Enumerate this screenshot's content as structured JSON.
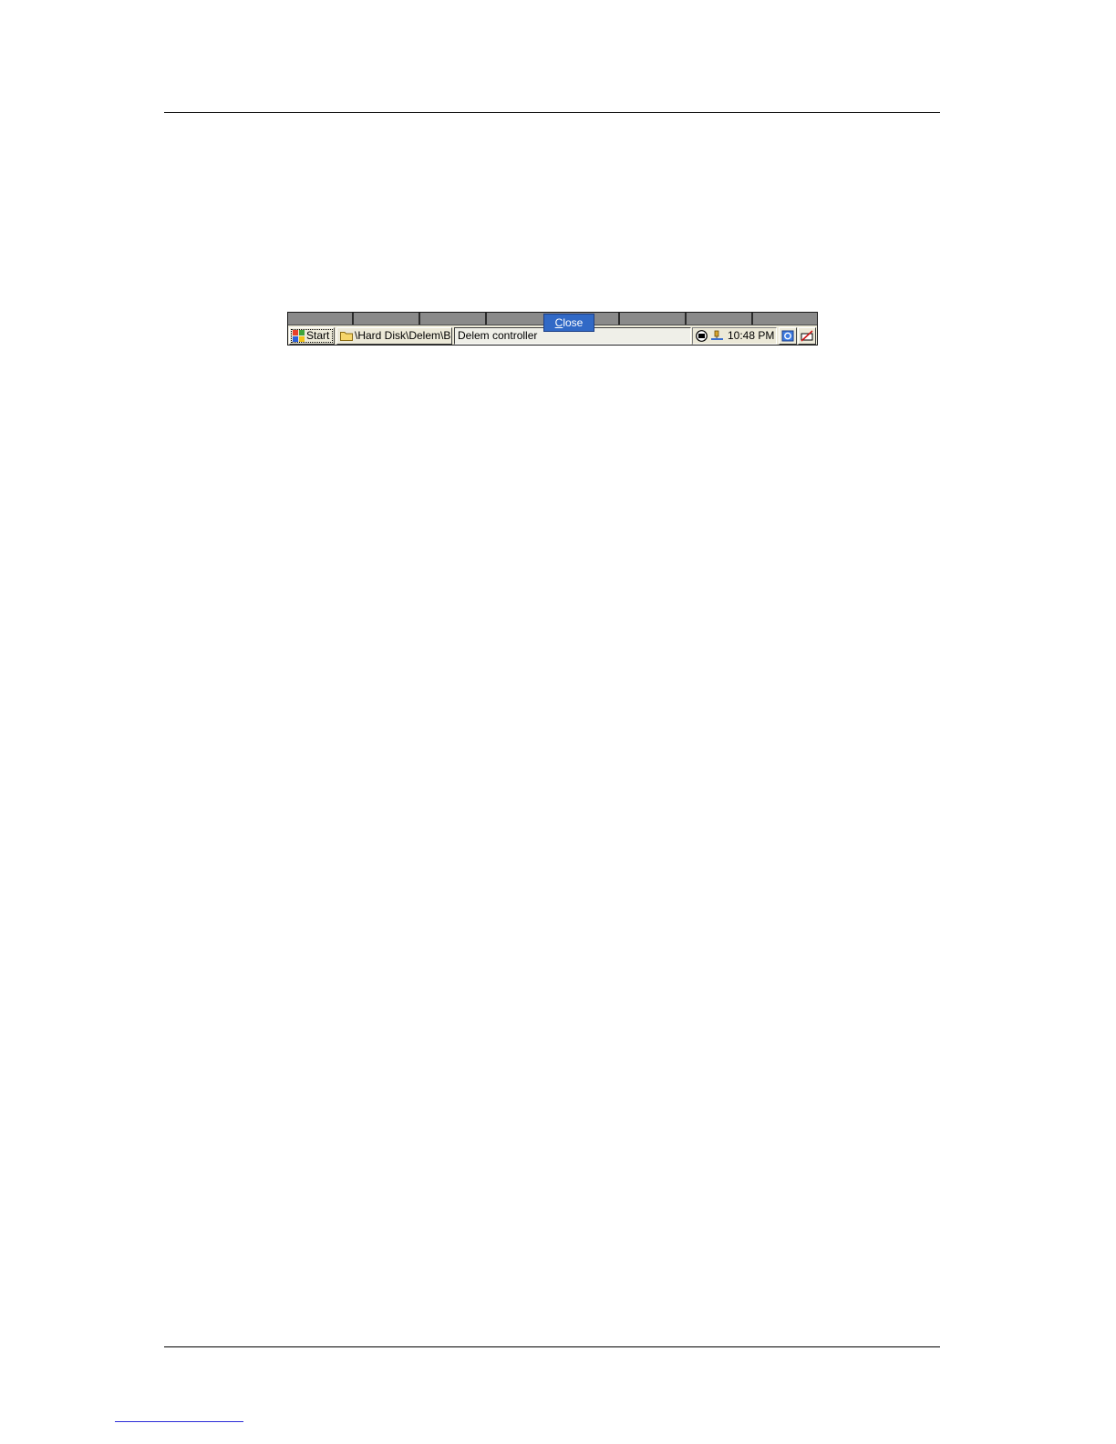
{
  "taskbar": {
    "start_label": "Start",
    "folder_window_label": "\\Hard Disk\\Delem\\Bin",
    "controller_window_label": "Delem controller",
    "close_popup_label": "Close",
    "clock": "10:48 PM"
  },
  "icons": {
    "start": "windows-flag-icon",
    "folder": "folder-icon",
    "tray_1": "input-method-icon",
    "tray_2": "network-icon",
    "desktop": "show-desktop-icon",
    "keyboard": "keyboard-icon"
  },
  "colors": {
    "popup_highlight": "#3169c6",
    "taskbar_face": "#ece9d8"
  }
}
